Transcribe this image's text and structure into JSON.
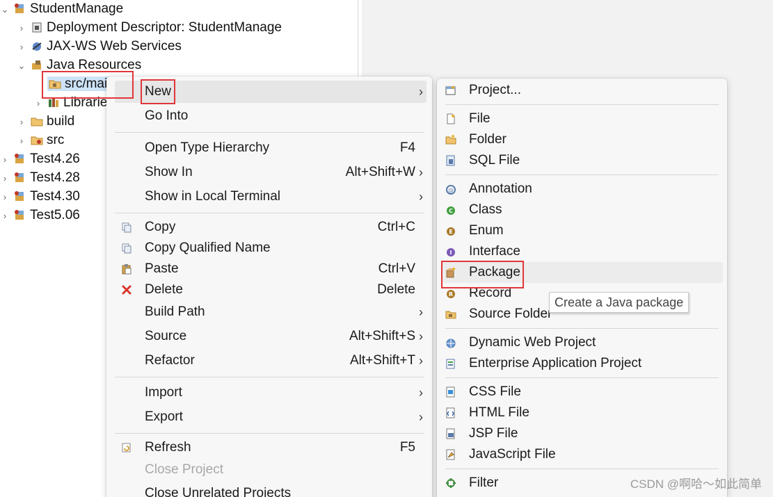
{
  "tree": {
    "items": [
      {
        "label": "StudentManage",
        "twisty": "⌄",
        "icon": "project-icon"
      },
      {
        "label": "Deployment Descriptor: StudentManage",
        "twisty": "›",
        "icon": "deployment-descriptor-icon"
      },
      {
        "label": "JAX-WS Web Services",
        "twisty": "›",
        "icon": "web-services-icon"
      },
      {
        "label": "Java Resources",
        "twisty": "⌄",
        "icon": "java-resources-icon"
      },
      {
        "label": "src/mai",
        "twisty": "",
        "icon": "source-folder-icon"
      },
      {
        "label": "Librarie",
        "twisty": "›",
        "icon": "libraries-icon"
      },
      {
        "label": "build",
        "twisty": "›",
        "icon": "folder-icon"
      },
      {
        "label": "src",
        "twisty": "›",
        "icon": "src-folder-icon"
      },
      {
        "label": "Test4.26",
        "twisty": "›",
        "icon": "project-icon"
      },
      {
        "label": "Test4.28",
        "twisty": "›",
        "icon": "project-icon"
      },
      {
        "label": "Test4.30",
        "twisty": "›",
        "icon": "project-icon"
      },
      {
        "label": "Test5.06",
        "twisty": "›",
        "icon": "project-icon"
      }
    ]
  },
  "context_menu": {
    "items": [
      {
        "label": "New",
        "shortcut": "",
        "submenu": true
      },
      {
        "label": "Go Into",
        "shortcut": ""
      },
      {
        "label": "Open Type Hierarchy",
        "shortcut": "F4"
      },
      {
        "label": "Show In",
        "shortcut": "Alt+Shift+W",
        "submenu": true
      },
      {
        "label": "Show in Local Terminal",
        "shortcut": "",
        "submenu": true
      },
      {
        "label": "Copy",
        "shortcut": "Ctrl+C",
        "icon": "copy-icon"
      },
      {
        "label": "Copy Qualified Name",
        "shortcut": "",
        "icon": "copy-qualified-icon"
      },
      {
        "label": "Paste",
        "shortcut": "Ctrl+V",
        "icon": "paste-icon"
      },
      {
        "label": "Delete",
        "shortcut": "Delete",
        "icon": "delete-icon"
      },
      {
        "label": "Build Path",
        "shortcut": "",
        "submenu": true
      },
      {
        "label": "Source",
        "shortcut": "Alt+Shift+S",
        "submenu": true
      },
      {
        "label": "Refactor",
        "shortcut": "Alt+Shift+T",
        "submenu": true
      },
      {
        "label": "Import",
        "shortcut": "",
        "submenu": true
      },
      {
        "label": "Export",
        "shortcut": "",
        "submenu": true
      },
      {
        "label": "Refresh",
        "shortcut": "F5",
        "icon": "refresh-icon"
      },
      {
        "label": "Close Project",
        "shortcut": "",
        "disabled": true
      },
      {
        "label": "Close Unrelated Projects",
        "shortcut": ""
      }
    ],
    "arrow": "›"
  },
  "submenu": {
    "items": [
      {
        "label": "Project...",
        "icon": "new-project-icon"
      },
      {
        "label": "File",
        "icon": "file-icon"
      },
      {
        "label": "Folder",
        "icon": "folder-icon"
      },
      {
        "label": "SQL File",
        "icon": "sql-file-icon"
      },
      {
        "label": "Annotation",
        "icon": "annotation-icon"
      },
      {
        "label": "Class",
        "icon": "class-icon"
      },
      {
        "label": "Enum",
        "icon": "enum-icon"
      },
      {
        "label": "Interface",
        "icon": "interface-icon"
      },
      {
        "label": "Package",
        "icon": "package-icon"
      },
      {
        "label": "Record",
        "icon": "record-icon"
      },
      {
        "label": "Source Folder",
        "icon": "source-folder-icon"
      },
      {
        "label": "Dynamic Web Project",
        "icon": "dynamic-web-project-icon"
      },
      {
        "label": "Enterprise Application Project",
        "icon": "enterprise-app-icon"
      },
      {
        "label": "CSS File",
        "icon": "css-file-icon"
      },
      {
        "label": "HTML File",
        "icon": "html-file-icon"
      },
      {
        "label": "JSP File",
        "icon": "jsp-file-icon"
      },
      {
        "label": "JavaScript File",
        "icon": "javascript-file-icon"
      },
      {
        "label": "Filter",
        "icon": "filter-icon"
      }
    ]
  },
  "tooltip": {
    "text": "Create a Java package"
  },
  "watermark": {
    "text": "CSDN @啊哈～如此简单"
  },
  "colors": {
    "highlight_box": "#e0363a",
    "selection": "#cde3f7"
  }
}
